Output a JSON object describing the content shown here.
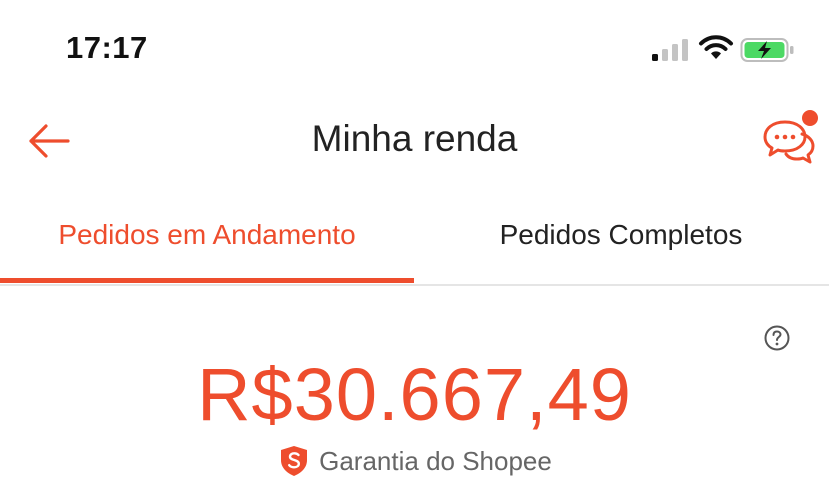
{
  "status_bar": {
    "time": "17:17",
    "icons": [
      "cellular-signal-icon",
      "wifi-icon",
      "battery-charging-icon"
    ]
  },
  "header": {
    "title": "Minha renda",
    "back_icon": "arrow-left-icon",
    "chat_icon": "chat-bubbles-icon"
  },
  "tabs": [
    {
      "label": "Pedidos em Andamento",
      "active": true
    },
    {
      "label": "Pedidos Completos",
      "active": false
    }
  ],
  "summary": {
    "amount": "R$30.667,49",
    "guarantee_label": "Garantia do Shopee",
    "guarantee_icon": "shopee-shield-icon",
    "help_icon": "question-circle-icon"
  },
  "colors": {
    "accent": "#ee4d2d",
    "battery_green": "#4cd964",
    "text_dark": "#222222",
    "text_muted": "#666666"
  }
}
